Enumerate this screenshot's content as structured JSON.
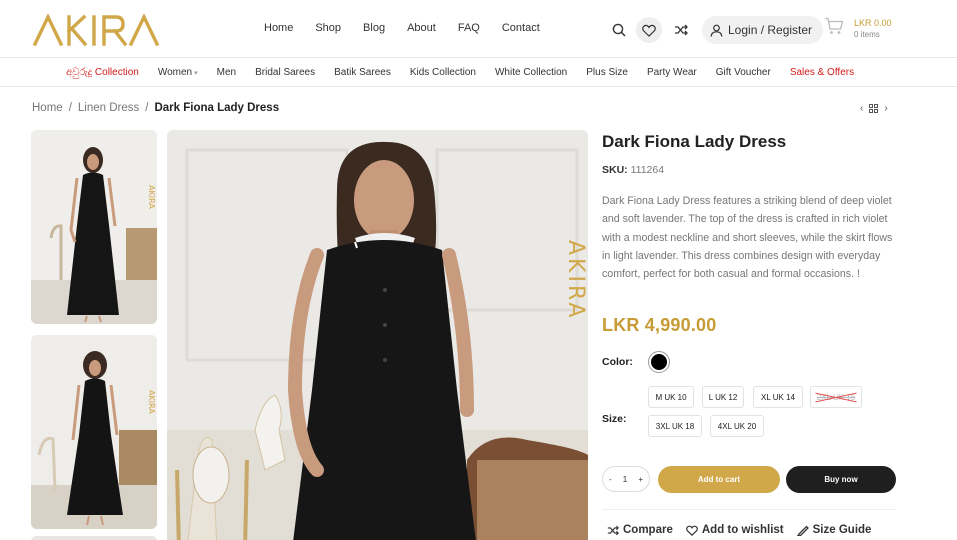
{
  "brand": {
    "logo_text": "AKIRA",
    "accent": "#c79c36"
  },
  "main_nav": [
    {
      "label": "Home"
    },
    {
      "label": "Shop"
    },
    {
      "label": "Blog"
    },
    {
      "label": "About"
    },
    {
      "label": "FAQ"
    },
    {
      "label": "Contact"
    }
  ],
  "header": {
    "search_icon": "search-icon",
    "wishlist_icon": "heart-icon",
    "compare_icon": "shuffle-icon",
    "login_label": "Login / Register",
    "cart_amount": "LKR 0.00",
    "cart_items": "0 items"
  },
  "categories": [
    {
      "label": "අවුරුදු Collection",
      "color": "#d21a1a"
    },
    {
      "label": "Women",
      "has_dropdown": true
    },
    {
      "label": "Men"
    },
    {
      "label": "Bridal Sarees"
    },
    {
      "label": "Batik Sarees"
    },
    {
      "label": "Kids Collection"
    },
    {
      "label": "White Collection"
    },
    {
      "label": "Plus Size"
    },
    {
      "label": "Party Wear"
    },
    {
      "label": "Gift Voucher"
    },
    {
      "label": "Sales & Offers",
      "color": "#d21a1a"
    }
  ],
  "breadcrumb": {
    "home": "Home",
    "category": "Linen Dress",
    "current": "Dark Fiona Lady Dress"
  },
  "product": {
    "title": "Dark Fiona Lady Dress",
    "sku_label": "SKU:",
    "sku": "111264",
    "description": "Dark Fiona Lady Dress   features a striking blend of deep violet and soft lavender. The top of the dress is crafted in rich violet with a modest neckline and short sleeves, while the skirt flows in light lavender. This dress combines design with everyday comfort, perfect for both casual and formal occasions. !",
    "price": "LKR 4,990.00",
    "color_label": "Color:",
    "selected_color": "#000000",
    "size_label": "Size:",
    "sizes": [
      {
        "label": "M UK 10",
        "available": true
      },
      {
        "label": "L UK 12",
        "available": true
      },
      {
        "label": "XL UK 14",
        "available": true
      },
      {
        "label": "2XL UK 16",
        "available": false
      },
      {
        "label": "3XL UK 18",
        "available": true
      },
      {
        "label": "4XL UK 20",
        "available": true
      }
    ],
    "quantity": "1",
    "qty_minus": "-",
    "qty_plus": "+",
    "add_to_cart": "Add to cart",
    "buy_now": "Buy now",
    "compare": "Compare",
    "wishlist": "Add to wishlist",
    "size_guide": "Size Guide"
  },
  "watermark": "AKIRA"
}
